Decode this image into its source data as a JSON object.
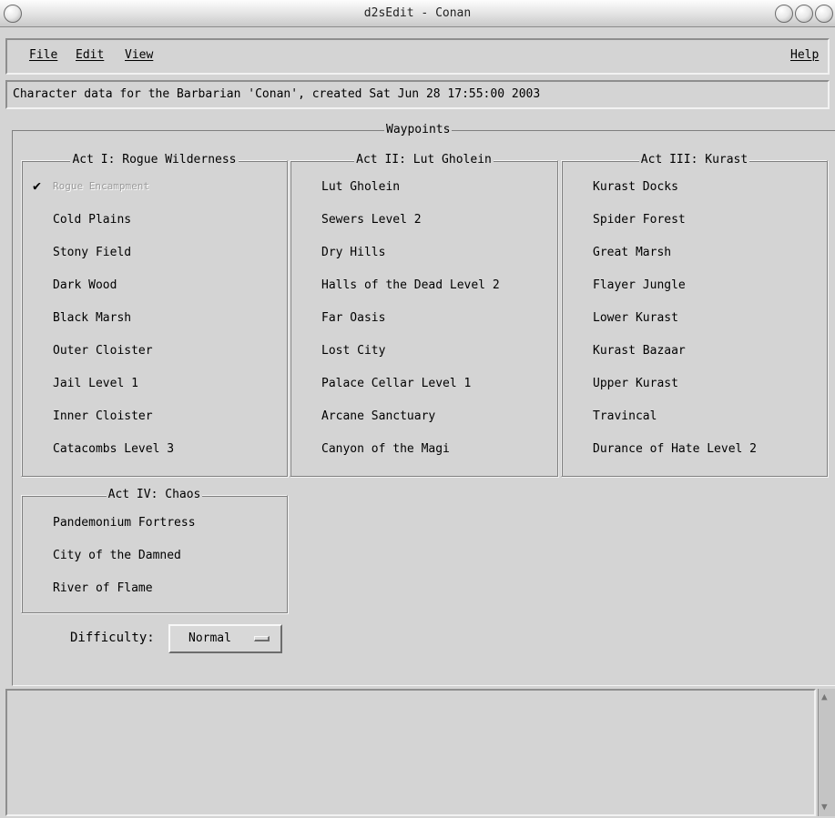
{
  "window": {
    "title": "d2sEdit - Conan"
  },
  "menu": {
    "file": "File",
    "edit": "Edit",
    "view": "View",
    "help": "Help"
  },
  "info_text": "Character data for the Barbarian 'Conan', created Sat Jun 28 17:55:00 2003",
  "waypoints": {
    "legend": "Waypoints",
    "acts": [
      {
        "title": "Act I: Rogue Wilderness",
        "items": [
          "Rogue Encampment",
          "Cold Plains",
          "Stony Field",
          "Dark Wood",
          "Black Marsh",
          "Outer Cloister",
          "Jail Level 1",
          "Inner Cloister",
          "Catacombs Level 3"
        ]
      },
      {
        "title": "Act II: Lut Gholein",
        "items": [
          "Lut Gholein",
          "Sewers Level 2",
          "Dry Hills",
          "Halls of the Dead Level 2",
          "Far Oasis",
          "Lost City",
          "Palace Cellar Level 1",
          "Arcane Sanctuary",
          "Canyon of the Magi"
        ]
      },
      {
        "title": "Act III: Kurast",
        "items": [
          "Kurast Docks",
          "Spider Forest",
          "Great Marsh",
          "Flayer Jungle",
          "Lower Kurast",
          "Kurast Bazaar",
          "Upper Kurast",
          "Travincal",
          "Durance of Hate Level 2"
        ]
      },
      {
        "title": "Act IV: Chaos",
        "items": [
          "Pandemonium Fortress",
          "City of the Damned",
          "River of Flame"
        ]
      }
    ]
  },
  "difficulty": {
    "label": "Difficulty:",
    "value": "Normal"
  },
  "log_text": ""
}
